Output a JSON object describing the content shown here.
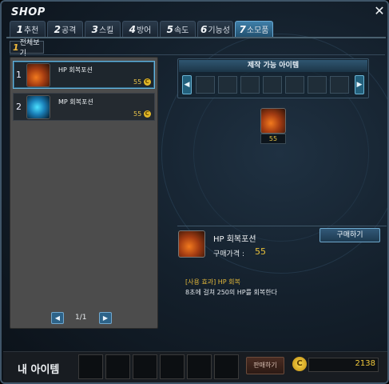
{
  "window": {
    "title": "SHOP",
    "close_glyph": "✕"
  },
  "tabs": [
    {
      "num": "1",
      "label": "추천"
    },
    {
      "num": "2",
      "label": "공격"
    },
    {
      "num": "3",
      "label": "스킬"
    },
    {
      "num": "4",
      "label": "방어"
    },
    {
      "num": "5",
      "label": "속도"
    },
    {
      "num": "6",
      "label": "기능성"
    },
    {
      "num": "7",
      "label": "소모품",
      "active": true
    }
  ],
  "subtab": {
    "num": "1",
    "label": "전체보기"
  },
  "items": [
    {
      "index": "1",
      "name": "HP 회복포션",
      "price": "55",
      "icon": "hp-potion-icon",
      "selected": true
    },
    {
      "index": "2",
      "name": "MP 회복포션",
      "price": "55",
      "icon": "mp-potion-icon",
      "selected": false
    }
  ],
  "pager": {
    "page": "1/1",
    "prev_glyph": "◀",
    "next_glyph": "▶"
  },
  "craft": {
    "title": "제작 가능 아이템",
    "left_glyph": "◀",
    "right_glyph": "▶",
    "result_qty": "55"
  },
  "detail": {
    "name": "HP 회복포션",
    "price_label": "구매가격 :",
    "price": "55",
    "buy_label": "구매하기",
    "effect_label": "[사용 효과] HP 회복",
    "effect_desc": "8초에 걸쳐 250의 HP를 회복한다"
  },
  "bottom": {
    "my_items_label": "내 아이템",
    "sell_label": "판매하기",
    "gold_symbol": "C",
    "gold": "2138"
  },
  "coin_symbol": "C",
  "colors": {
    "accent": "#68b5de",
    "gold": "#e9c13a",
    "active_tab": "#3f7fa9"
  }
}
